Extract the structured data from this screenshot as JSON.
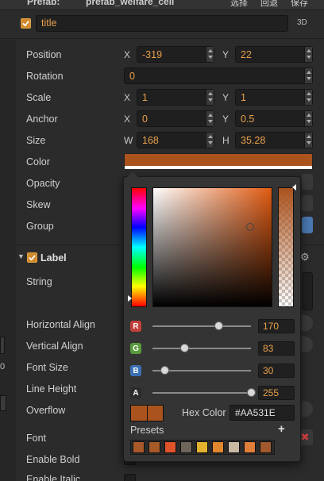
{
  "header": {
    "prefab_label": "Prefab:",
    "prefab_name": "prefab_welfare_cell",
    "buttons": [
      "选择",
      "回退",
      "保存"
    ]
  },
  "node": {
    "name": "title",
    "tag": "3D"
  },
  "props": {
    "position": {
      "label": "Position",
      "x_axis": "X",
      "x": "-319",
      "y_axis": "Y",
      "y": "22"
    },
    "rotation": {
      "label": "Rotation",
      "value": "0"
    },
    "scale": {
      "label": "Scale",
      "x_axis": "X",
      "x": "1",
      "y_axis": "Y",
      "y": "1"
    },
    "anchor": {
      "label": "Anchor",
      "x_axis": "X",
      "x": "0",
      "y_axis": "Y",
      "y": "0.5"
    },
    "size": {
      "label": "Size",
      "w_axis": "W",
      "w": "168",
      "h_axis": "H",
      "h": "35.28"
    },
    "color": {
      "label": "Color",
      "value": "#AA531E"
    },
    "opacity": {
      "label": "Opacity"
    },
    "skew": {
      "label": "Skew"
    },
    "group": {
      "label": "Group"
    }
  },
  "label_component": {
    "title": "Label",
    "rows": [
      "String",
      "Horizontal Align",
      "Vertical Align",
      "Font Size",
      "Line Height",
      "Overflow",
      "Font",
      "Enable Bold",
      "Enable Italic"
    ]
  },
  "color_picker": {
    "channels": [
      {
        "key": "R",
        "value": "170",
        "badge_color": "#c2403a",
        "fraction": 0.667
      },
      {
        "key": "G",
        "value": "83",
        "badge_color": "#5a9a3c",
        "fraction": 0.325
      },
      {
        "key": "B",
        "value": "30",
        "badge_color": "#3b6fb6",
        "fraction": 0.118
      },
      {
        "key": "A",
        "value": "255",
        "badge_color": "#2b2b2b",
        "fraction": 1.0
      }
    ],
    "hex_label": "Hex Color",
    "hex_value": "#AA531E",
    "presets_label": "Presets",
    "add_icon": "plus-icon",
    "presets": [
      "#A9582A",
      "#A65A28",
      "#E0532A",
      "#6E6658",
      "#E4B22E",
      "#E0862E",
      "#C8B9A2",
      "#E07E3C",
      "#A1582E"
    ]
  }
}
